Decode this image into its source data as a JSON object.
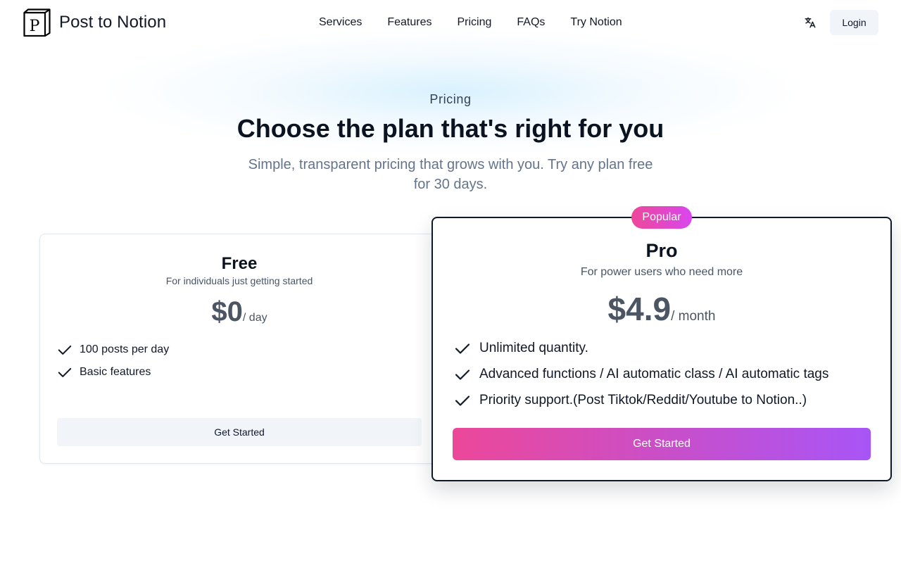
{
  "header": {
    "brand": "Post to Notion",
    "nav": [
      {
        "label": "Services"
      },
      {
        "label": "Features"
      },
      {
        "label": "Pricing"
      },
      {
        "label": "FAQs"
      },
      {
        "label": "Try Notion"
      }
    ],
    "language_icon": "translate-icon",
    "login_label": "Login"
  },
  "hero": {
    "eyebrow": "Pricing",
    "title": "Choose the plan that's right for you",
    "subtitle": "Simple, transparent pricing that grows with you. Try any plan free for 30 days."
  },
  "plans": [
    {
      "name": "Free",
      "description": "For individuals just getting started",
      "price": "$0",
      "unit": "/ day",
      "features": [
        "100 posts per day",
        "Basic features"
      ],
      "cta": "Get Started"
    },
    {
      "name": "Pro",
      "badge": "Popular",
      "description": "For power users who need more",
      "price": "$4.9",
      "unit": "/ month",
      "features": [
        "Unlimited quantity.",
        "Advanced functions / AI automatic class / AI automatic tags",
        "Priority support.(Post Tiktok/Reddit/Youtube to Notion..)"
      ],
      "cta": "Get Started"
    }
  ],
  "colors": {
    "accent_from": "#ec4899",
    "accent_to": "#a855f7",
    "text_primary": "#0f172a",
    "text_muted": "#64748b"
  }
}
